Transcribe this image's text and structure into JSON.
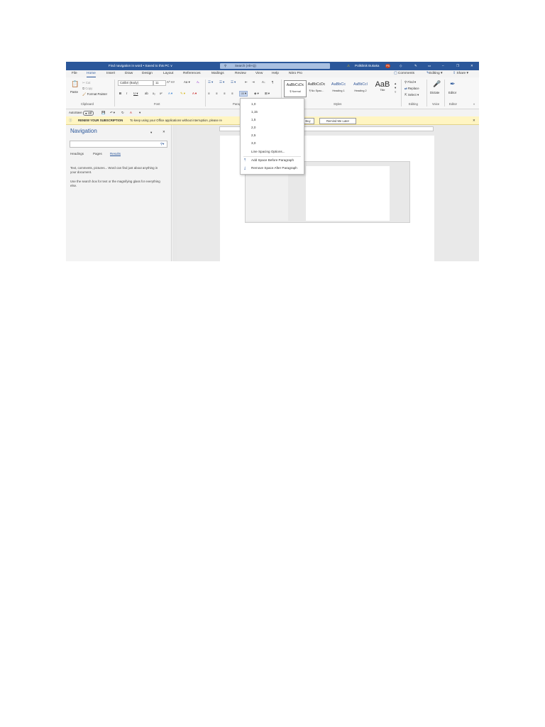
{
  "titlebar": {
    "doc_title": "Find navigation in word • Saved to this PC ∨",
    "search_placeholder": "Search (Alt+Q)",
    "warning_icon": "⚠",
    "user_name": "Poliklinik Bukaka",
    "avatar_initials": "PB",
    "minimize": "–",
    "restore": "❐",
    "close": "✕"
  },
  "tabs": [
    "File",
    "Home",
    "Insert",
    "Draw",
    "Design",
    "Layout",
    "References",
    "Mailings",
    "Review",
    "View",
    "Help",
    "Nitro Pro"
  ],
  "tab_actions": {
    "comments": "Comments",
    "editing": "Editing",
    "share": "Share"
  },
  "ribbon": {
    "clipboard": {
      "paste": "Paste",
      "cut": "Cut",
      "copy": "Copy",
      "format_painter": "Format Painter",
      "label": "Clipboard"
    },
    "font": {
      "name": "Calibri (Body)",
      "size": "11",
      "label": "Font"
    },
    "paragraph": {
      "label": "Paragraph"
    },
    "styles": {
      "label": "Styles",
      "items": [
        {
          "preview": "AaBbCcDc",
          "name": "¶ Normal"
        },
        {
          "preview": "AaBbCcDc",
          "name": "¶ No Spac..."
        },
        {
          "preview": "AaBbCc",
          "name": "Heading 1"
        },
        {
          "preview": "AaBbCcI",
          "name": "Heading 2"
        },
        {
          "preview": "AaB",
          "name": "Title"
        }
      ]
    },
    "editing": {
      "find": "Find",
      "replace": "Replace",
      "select": "Select",
      "label": "Editing"
    },
    "voice": {
      "dictate": "Dictate",
      "label": "Voice"
    },
    "editor": {
      "editor": "Editor",
      "label": "Editor"
    }
  },
  "qat": {
    "autosave": "AutoSave",
    "toggle": "Off"
  },
  "infobar": {
    "title": "RENEW YOUR SUBSCRIPTION",
    "message": "To keep using your Office applications without interruption, please re",
    "buy": "Buy",
    "remind": "Remind Me Later"
  },
  "navigation": {
    "title": "Navigation",
    "tabs": [
      "Headings",
      "Pages",
      "Results"
    ],
    "text1": "Text, comments, pictures... Word can find just about anything in your document.",
    "text2": "Use the search box for text or the magnifying glass for everything else."
  },
  "line_spacing_menu": {
    "options": [
      "1,0",
      "1,15",
      "1,5",
      "2,0",
      "2,5",
      "3,0"
    ],
    "more": "Line Spacing Options...",
    "add_before": "Add Space Before Paragraph",
    "remove_after": "Remove Space After Paragraph"
  },
  "colors": {
    "accent": "#2b579a",
    "infobar": "#fff5c2",
    "avatar": "#c43e1c"
  }
}
